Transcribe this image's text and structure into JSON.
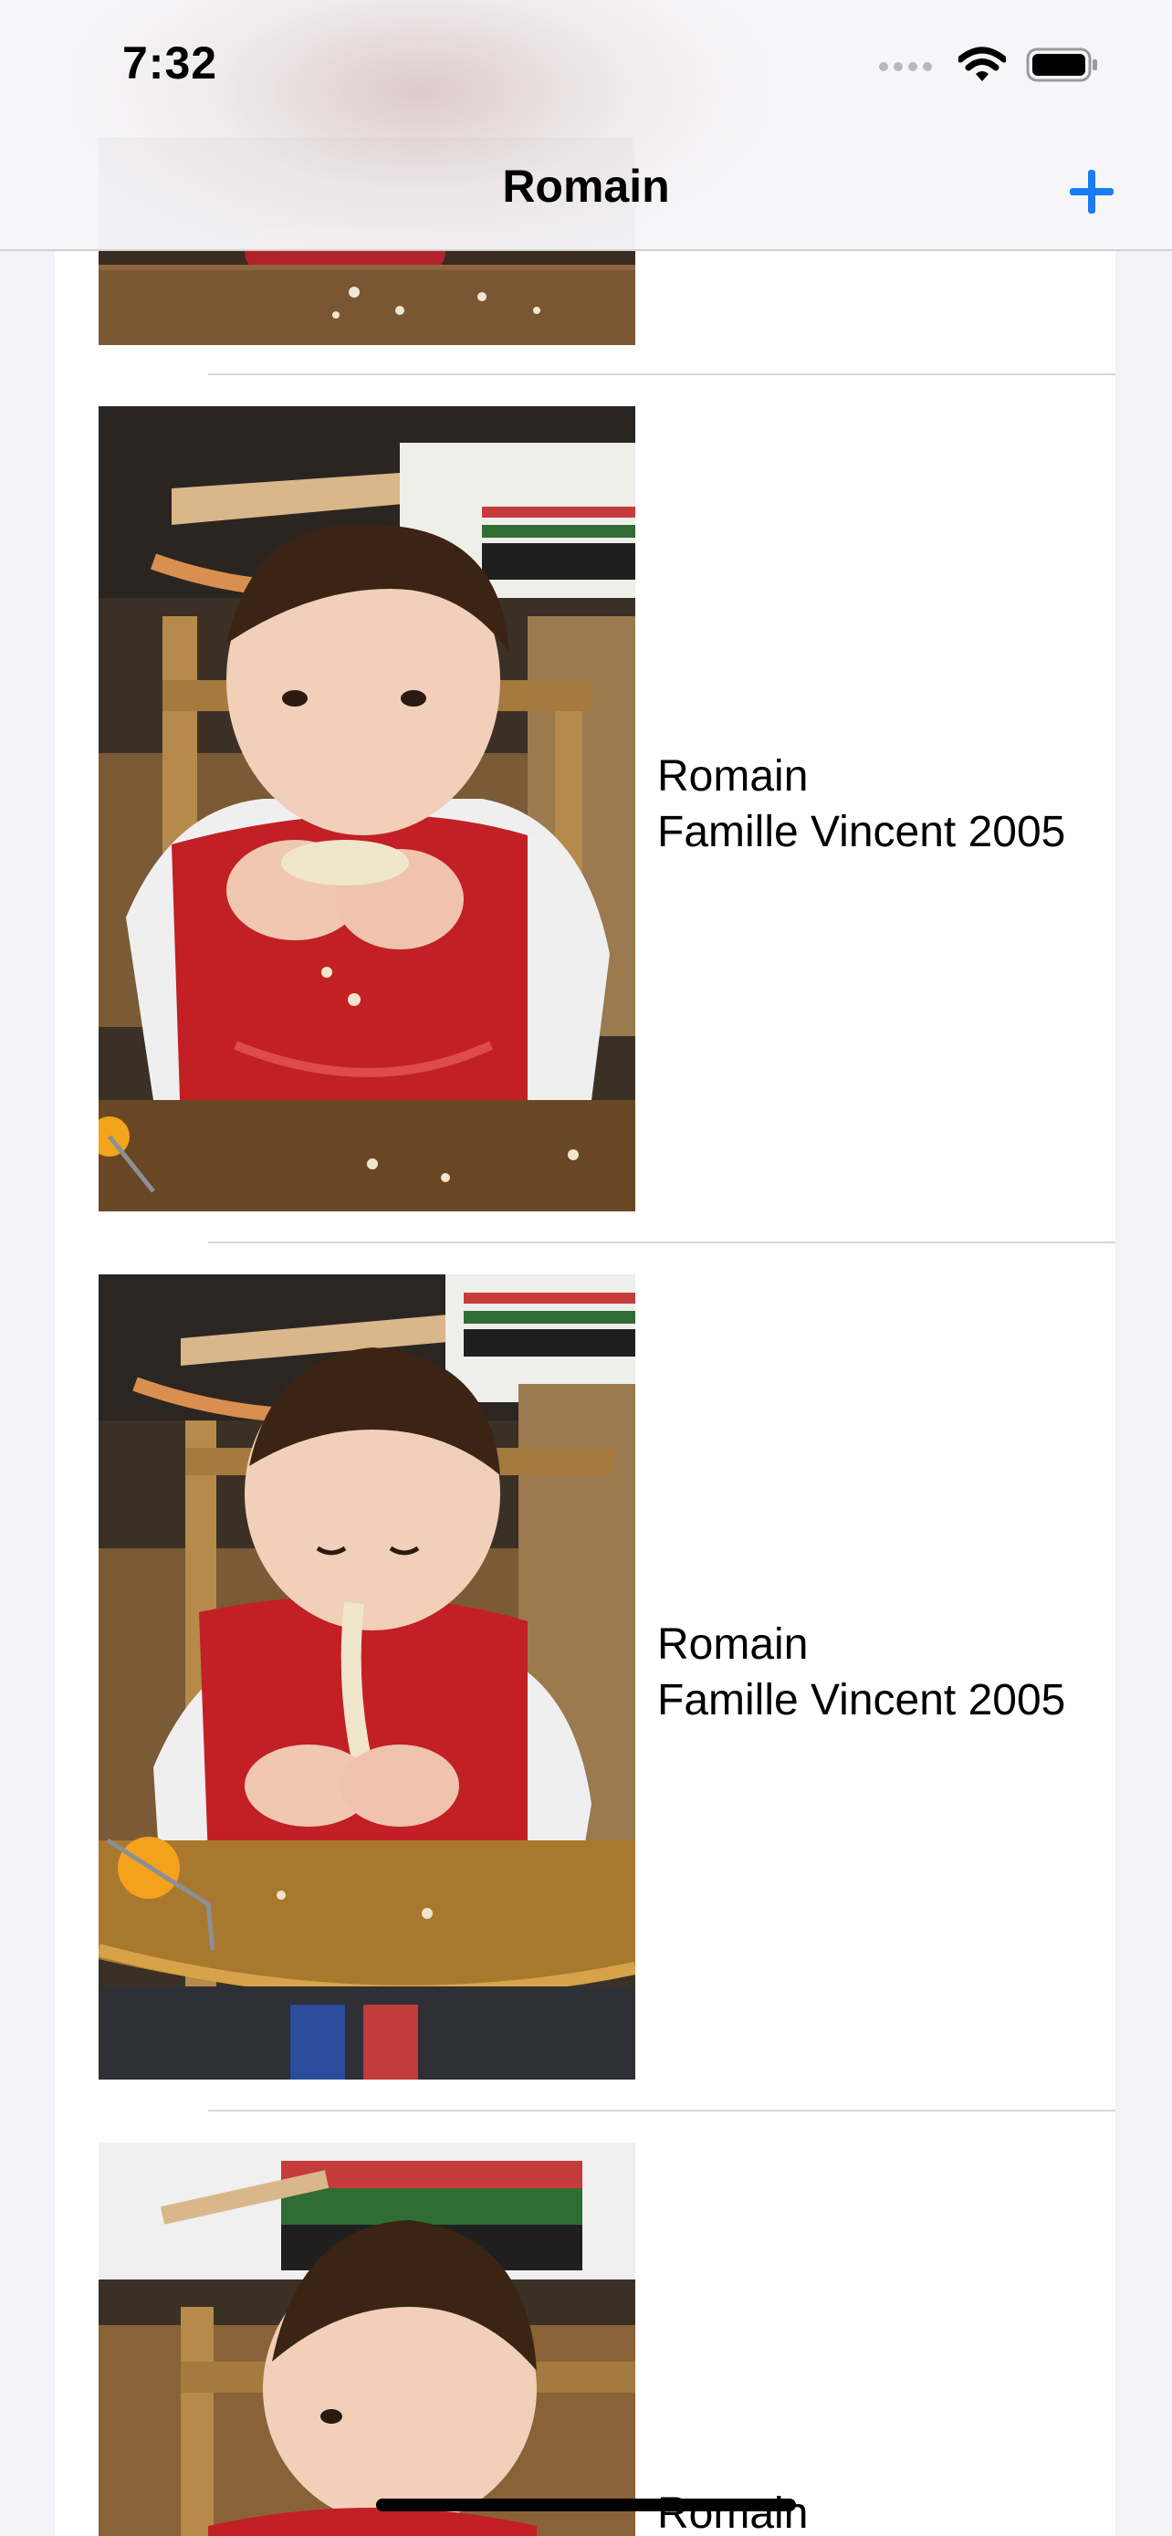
{
  "status_bar": {
    "time": "7:32"
  },
  "nav": {
    "title": "Romain",
    "add_icon": "plus-icon",
    "accent_color": "#1a7cf5"
  },
  "rows": [
    {
      "title": "Romain",
      "subtitle": "Famille Vincent 2005"
    },
    {
      "title": "Romain",
      "subtitle": "Famille Vincent 2005"
    },
    {
      "title": "Romain",
      "subtitle": "Famille Vincent 2005"
    },
    {
      "title": "Romain",
      "subtitle": ""
    }
  ]
}
